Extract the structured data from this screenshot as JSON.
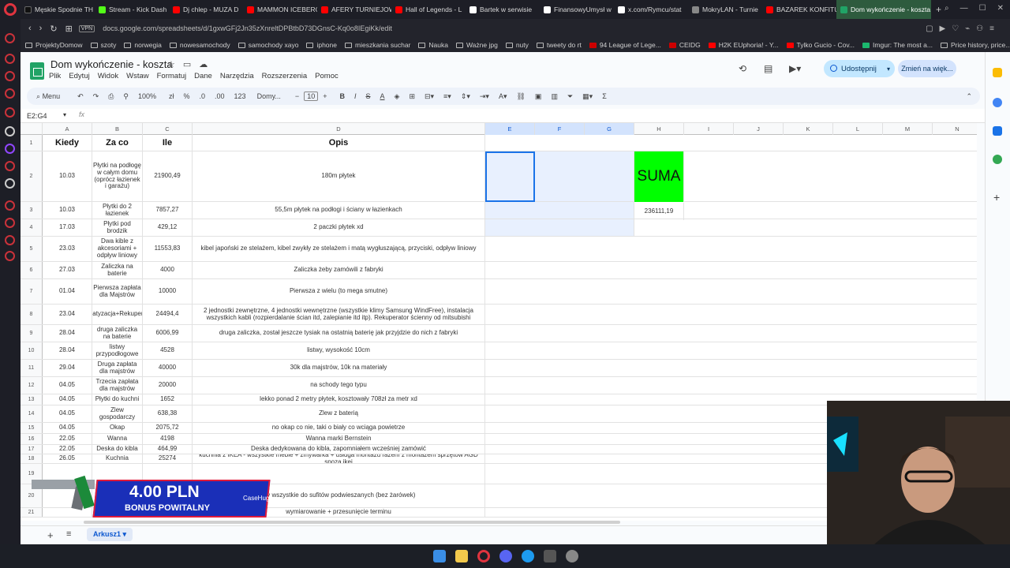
{
  "browser": {
    "tabs": [
      {
        "label": "Męskie Spodnie TH",
        "color": "#111111"
      },
      {
        "label": "Stream - Kick Dash",
        "color": "#53fc18"
      },
      {
        "label": "Dj chlep - MUZA D",
        "color": "#ff0000"
      },
      {
        "label": "MAMMON ICEBERG",
        "color": "#ff0000"
      },
      {
        "label": "AFERY TURNIEJOW",
        "color": "#ff0000"
      },
      {
        "label": "Hall of Legends - L",
        "color": "#ff0000"
      },
      {
        "label": "Bartek w serwisie",
        "color": "#ffffff"
      },
      {
        "label": "FinansowyUmysł w",
        "color": "#ffffff"
      },
      {
        "label": "x.com/Rymcu/stat",
        "color": "#ffffff"
      },
      {
        "label": "MokryLAN - Turnie",
        "color": "#888888"
      },
      {
        "label": "BAZAREK KONFITU",
        "color": "#ff0000"
      },
      {
        "label": "Dom wykończenie - koszta",
        "color": "#21a366"
      }
    ],
    "vpn": "VPN",
    "url": "docs.google.com/spreadsheets/d/1gxwGFj2Jn35zXnreltDPBtbD73DGnsC-Kq0o8IEgiKk/edit",
    "bookmarks": [
      "ProjektyDomow",
      "szoty",
      "norwegia",
      "nowesamochody",
      "samochody xayo",
      "iphone",
      "mieszkania suchar",
      "Nauka",
      "Ważne jpg",
      "nuty",
      "tweety do rt",
      "94 League of Lege...",
      "CEIDG",
      "H2K EUphoria! - Y...",
      "Tylko Gucio - Cov...",
      "Imgur: The most a...",
      "Price history, price..."
    ]
  },
  "sheets": {
    "title": "Dom wykończenie - koszta",
    "menu": [
      "Plik",
      "Edytuj",
      "Widok",
      "Wstaw",
      "Formatuj",
      "Dane",
      "Narzędzia",
      "Rozszerzenia",
      "Pomoc"
    ],
    "share_label": "Udostępnij",
    "change_label": "Zmień na więk...",
    "toolbar": {
      "menu_label": "Menu",
      "zoom": "100%",
      "currency": "zł",
      "percent": "%",
      "dec1": ".0",
      "dec2": ".00",
      "num": "123",
      "font": "Domy...",
      "font_size": "10"
    },
    "name_box": "E2:G4",
    "fx": "fx",
    "columns": [
      "A",
      "B",
      "C",
      "D",
      "E",
      "F",
      "G",
      "H",
      "I",
      "J",
      "K",
      "L",
      "M",
      "N"
    ],
    "header": {
      "a": "Kiedy",
      "b": "Za co",
      "c": "Ile",
      "d": "Opis"
    },
    "suma_label": "SUMA",
    "suma_value": "236111,19",
    "rows": [
      {
        "n": "2",
        "a": "10.03",
        "b": "Płytki na podłogę w całym domu (oprócz łazienek i garażu)",
        "c": "21900,49",
        "d": "180m płytek"
      },
      {
        "n": "3",
        "a": "10.03",
        "b": "Płytki do 2 łazienek",
        "c": "7857,27",
        "d": "55,5m płytek na podłogi i ściany w łazienkach"
      },
      {
        "n": "4",
        "a": "17.03",
        "b": "Płytki pod brodzik",
        "c": "429,12",
        "d": "2 paczki płytek xd"
      },
      {
        "n": "5",
        "a": "23.03",
        "b": "Dwa kible z akcesoriami + odpływ liniowy",
        "c": "11553,83",
        "d": "kibel japoński ze stelażem, kibel zwykły ze stelażem i matą wygłuszającą, przyciski, odpływ liniowy"
      },
      {
        "n": "6",
        "a": "27.03",
        "b": "Zaliczka na baterie",
        "c": "4000",
        "d": "Zaliczka żeby zamówili z fabryki"
      },
      {
        "n": "7",
        "a": "01.04",
        "b": "Pierwsza zapłata dla Majstrów",
        "c": "10000",
        "d": "Pierwsza z wielu (to mega smutne)"
      },
      {
        "n": "8",
        "a": "23.04",
        "b": "Klimatyzacja+Rekuperator",
        "c": "24494,4",
        "d": "2 jednostki zewnętrzne, 4 jednostki wewnętrzne (wszystkie klimy Samsung WindFree), instalacja wszystkich kabli (rozpierdalanie ścian itd, zalepianie itd itp). Rekuperator ścienny od mitsubishi"
      },
      {
        "n": "9",
        "a": "28.04",
        "b": "druga zaliczka na baterie",
        "c": "6006,99",
        "d": "druga zaliczka, został jeszcze tysiak na ostatnią baterię jak przyjdzie do nich z fabryki"
      },
      {
        "n": "10",
        "a": "28.04",
        "b": "listwy przypodłogowe",
        "c": "4528",
        "d": "listwy, wysokość 10cm"
      },
      {
        "n": "11",
        "a": "29.04",
        "b": "Druga zapłata dla majstrów",
        "c": "40000",
        "d": "30k dla majstrów, 10k na materiały"
      },
      {
        "n": "12",
        "a": "04.05",
        "b": "Trzecia zapłata dla majstrów",
        "c": "20000",
        "d": "na schody tego typu"
      },
      {
        "n": "13",
        "a": "04.05",
        "b": "Płytki do kuchni",
        "c": "1652",
        "d": "lekko ponad 2 metry płytek, kosztowały 708zł za metr xd"
      },
      {
        "n": "14",
        "a": "04.05",
        "b": "Zlew gospodarczy",
        "c": "638,38",
        "d": "Zlew z baterią"
      },
      {
        "n": "15",
        "a": "04.05",
        "b": "Okap",
        "c": "2075,72",
        "d": "no okap co nie, taki o biały co wciąga powietrze"
      },
      {
        "n": "16",
        "a": "22.05",
        "b": "Wanna",
        "c": "4198",
        "d": "Wanna marki Bernstein"
      },
      {
        "n": "17",
        "a": "22.05",
        "b": "Deska do kibla",
        "c": "464,99",
        "d": "Deska dedykowana do kibla, zapomniałem wcześniej zamówić"
      },
      {
        "n": "18",
        "a": "26.05",
        "b": "Kuchnia",
        "c": "25274",
        "d": "kuchnia z IKEA - wszystkie meble + zmywarka + usługa montażu razem z montażem sprzętów AGD spoza ikei"
      },
      {
        "n": "19",
        "a": "",
        "b": "",
        "c": "",
        "d": ""
      },
      {
        "n": "20",
        "a": "",
        "b": "",
        "c": "",
        "d": "...y wszystkie do sufitów podwieszanych (bez żarówek)"
      },
      {
        "n": "21",
        "a": "",
        "b": "",
        "c": "",
        "d": "wymiarowanie + przesunięcie terminu"
      }
    ],
    "sheet_tab": "Arkusz1"
  },
  "promo": {
    "amount": "4.00 PLN",
    "label": "BONUS POWITALNY",
    "brand": "CaseHug"
  }
}
